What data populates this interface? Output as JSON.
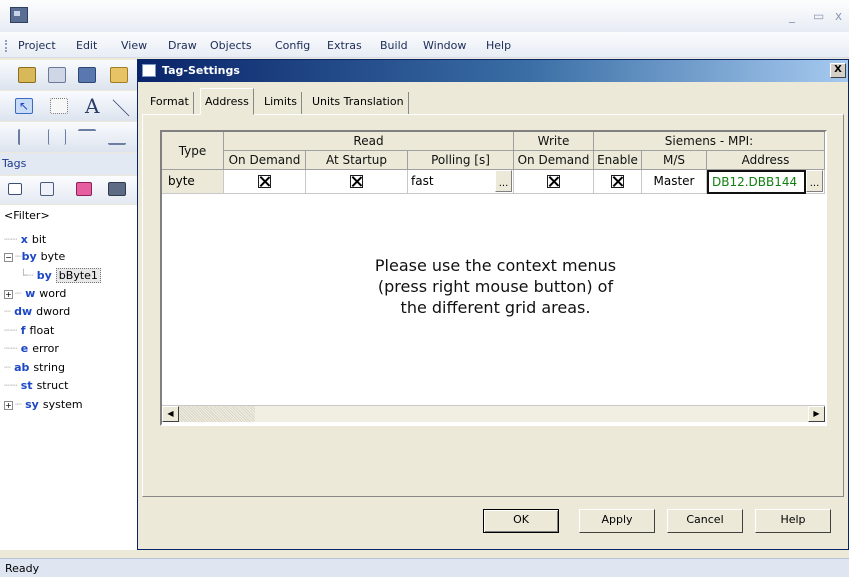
{
  "window": {
    "minimize_glyph": "_",
    "maximize_glyph": "▭",
    "close_glyph": "x"
  },
  "menu": [
    "Project",
    "Edit",
    "View",
    "Draw",
    "Objects",
    "Config",
    "Extras",
    "Build",
    "Window",
    "Help"
  ],
  "tags_panel": {
    "header": "Tags",
    "filter": "<Filter>",
    "tree": [
      {
        "type": "x",
        "label": "bit"
      },
      {
        "type": "by",
        "label": "byte",
        "expander": "−"
      },
      {
        "type": "by",
        "label": "bByte1"
      },
      {
        "type": "w",
        "label": "word",
        "expander": "+"
      },
      {
        "type": "dw",
        "label": "dword"
      },
      {
        "type": "f",
        "label": "float"
      },
      {
        "type": "e",
        "label": "error"
      },
      {
        "type": "ab",
        "label": "string"
      },
      {
        "type": "st",
        "label": "struct"
      },
      {
        "type": "sy",
        "label": "system",
        "expander": "+"
      }
    ]
  },
  "status": {
    "text": "Ready"
  },
  "dialog": {
    "title": "Tag-Settings",
    "close_glyph": "X",
    "tabs": [
      "Format",
      "Address",
      "Limits",
      "Units Translation"
    ],
    "active_tab": "Address",
    "grid": {
      "header_type": "Type",
      "group_read": "Read",
      "group_write": "Write",
      "group_siemens": "Siemens - MPI:",
      "col_on_demand_read": "On Demand",
      "col_at_startup": "At Startup",
      "col_polling": "Polling [s]",
      "col_on_demand_write": "On Demand",
      "col_enable": "Enable",
      "col_ms": "M/S",
      "col_address": "Address",
      "row": {
        "type": "byte",
        "on_demand_read": true,
        "at_startup": true,
        "polling": "fast",
        "on_demand_write": true,
        "enable": true,
        "ms": "Master",
        "address": "DB12.DBB144"
      },
      "ellipsis": "...",
      "message_line1": "Please use the context menus",
      "message_line2": "(press right mouse button) of",
      "message_line3": "the different grid areas.",
      "scroll_left": "◀",
      "scroll_right": "▶"
    },
    "buttons": {
      "ok": "OK",
      "apply": "Apply",
      "cancel": "Cancel",
      "help": "Help"
    }
  }
}
